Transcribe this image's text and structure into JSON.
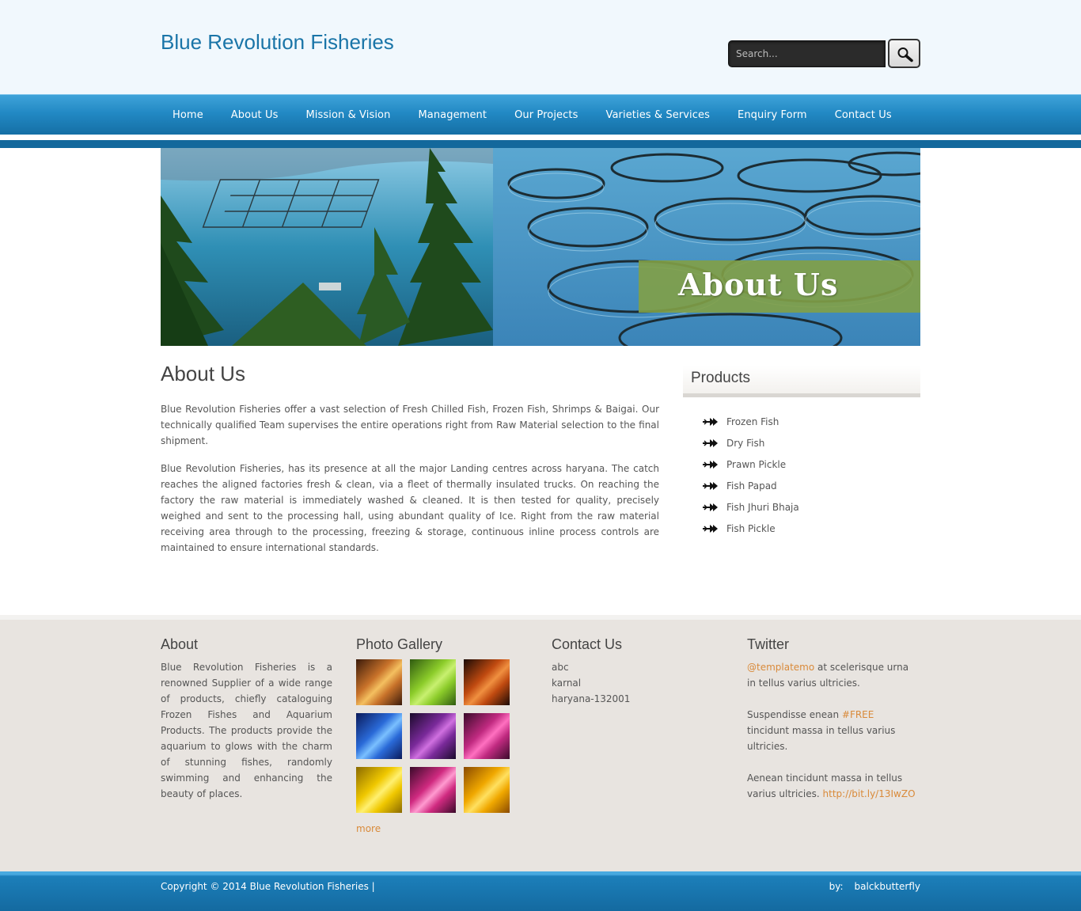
{
  "site": {
    "title": "Blue Revolution Fisheries"
  },
  "search": {
    "placeholder": "Search...",
    "button_icon": "magnifier-icon"
  },
  "nav": {
    "items": [
      {
        "label": "Home"
      },
      {
        "label": "About Us"
      },
      {
        "label": "Mission & Vision"
      },
      {
        "label": "Management"
      },
      {
        "label": "Our Projects"
      },
      {
        "label": "Varieties & Services"
      },
      {
        "label": "Enquiry Form"
      },
      {
        "label": "Contact Us"
      }
    ]
  },
  "banner": {
    "title": "About Us"
  },
  "content": {
    "heading": "About Us",
    "paragraphs": [
      "Blue Revolution Fisheries offer a vast selection of Fresh Chilled Fish, Frozen Fish, Shrimps & Baigai. Our technically qualified Team supervises the entire operations right from Raw Material selection to the final shipment.",
      "Blue Revolution Fisheries, has its presence at all the major Landing centres across haryana. The catch reaches the aligned factories fresh & clean, via a fleet of thermally insulated trucks. On reaching the factory the raw material is immediately washed & cleaned. It is then tested for quality, precisely weighed and sent to the processing hall, using abundant quality of Ice. Right from the raw material receiving area through to the processing, freezing & storage, continuous inline process controls are maintained to ensure international standards."
    ]
  },
  "sidebar": {
    "heading": "Products",
    "items": [
      {
        "label": "Frozen Fish"
      },
      {
        "label": "Dry Fish"
      },
      {
        "label": "Prawn Pickle"
      },
      {
        "label": "Fish Papad"
      },
      {
        "label": "Fish Jhuri Bhaja"
      },
      {
        "label": "Fish Pickle"
      }
    ]
  },
  "footer": {
    "about": {
      "heading": "About",
      "text": "Blue Revolution Fisheries is a renowned Supplier of a wide range of products, chiefly cataloguing Frozen Fishes and Aquarium Products. The products provide the aquarium to glows with the charm of stunning fishes, randomly swimming and enhancing the beauty of places."
    },
    "gallery": {
      "heading": "Photo Gallery",
      "more": "more",
      "thumb_colors": [
        [
          "#3a1a0a",
          "#c8722a",
          "#f4c060"
        ],
        [
          "#2f5a10",
          "#8ccc2a",
          "#c8f070"
        ],
        [
          "#1a0a05",
          "#c04a10",
          "#f09040"
        ],
        [
          "#0a1a5a",
          "#2a6ad8",
          "#7ac0ff"
        ],
        [
          "#1a0a2a",
          "#7a2a9a",
          "#d070e0"
        ],
        [
          "#3a0a2a",
          "#c02a80",
          "#ff70c0"
        ],
        [
          "#8a6a00",
          "#f0c800",
          "#fff070"
        ],
        [
          "#3a0a2a",
          "#d02a80",
          "#ff9ad0"
        ],
        [
          "#8a4a00",
          "#f0a800",
          "#ffe060"
        ]
      ]
    },
    "contact": {
      "heading": "Contact Us",
      "lines": [
        "abc",
        "karnal",
        "haryana-132001"
      ]
    },
    "twitter": {
      "heading": "Twitter",
      "tweets": [
        {
          "link": "@templatemo",
          "text": " at scelerisque urna in tellus varius ultricies."
        },
        {
          "pre": "Suspendisse enean ",
          "link": "#FREE",
          "text": " tincidunt massa in tellus varius ultricies."
        },
        {
          "pre": "Aenean tincidunt massa in tellus varius ultricies. ",
          "link": "http://bit.ly/13IwZO"
        }
      ]
    },
    "copyright": "Copyright © 2014 Blue Revolution Fisheries |",
    "credit_by": "by:",
    "credit_name": "balckbutterfly"
  },
  "colors": {
    "title_blue": "#1a75a8",
    "nav_blue": "#2289c4",
    "link_orange": "#d98a3a",
    "footer_bg": "#e8e4e0"
  }
}
